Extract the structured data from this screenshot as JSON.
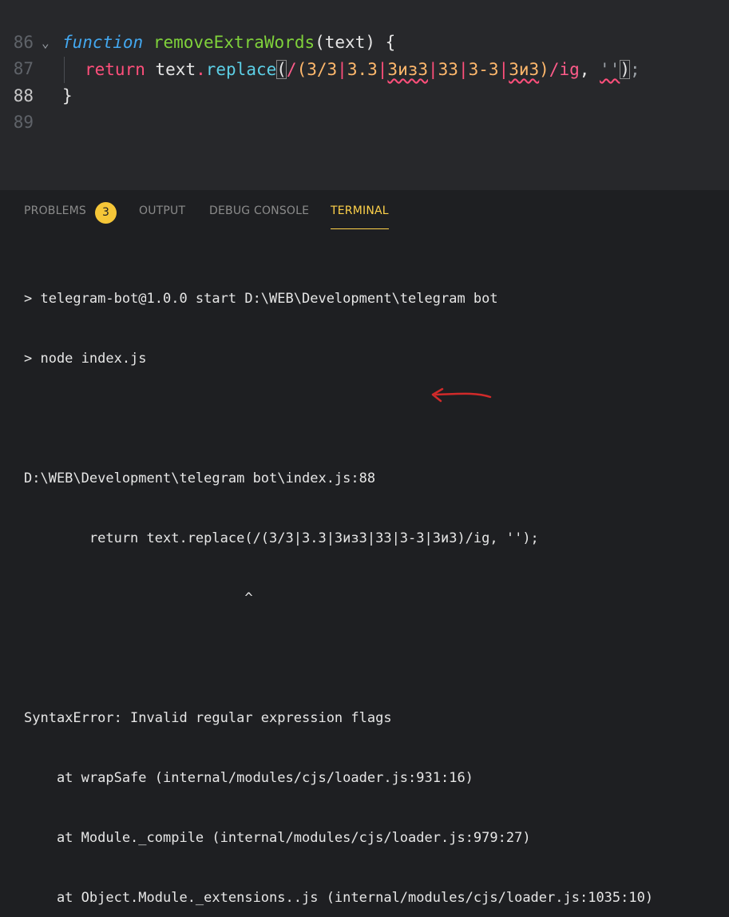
{
  "editor": {
    "lines": [
      {
        "number": "86"
      },
      {
        "number": "87",
        "fold": "⌄",
        "kw": "function",
        "name": "removeExtraWords",
        "open": "(",
        "param": "text",
        "close": ")",
        "brace": " {"
      },
      {
        "number": "88",
        "kw": "return",
        "obj": "text",
        "dot": ".",
        "method": "replace",
        "open": "(",
        "slash": "/",
        "group_open": "(",
        "p1": "3/3",
        "p2": "3.3",
        "p3": "3из3",
        "p4": "33",
        "p5": "3-3",
        "p6": "3и3",
        "bar": "|",
        "group_close": ")",
        "end_slash": "/",
        "flags": "ig",
        "comma": ", ",
        "str": "''",
        "close": ")",
        "semi": ";"
      },
      {
        "number": "89",
        "brace": "}"
      }
    ]
  },
  "panel": {
    "tabs": [
      {
        "label": "PROBLEMS",
        "badge": "3"
      },
      {
        "label": "OUTPUT"
      },
      {
        "label": "DEBUG CONSOLE"
      },
      {
        "label": "TERMINAL"
      }
    ],
    "terminal": [
      "> telegram-bot@1.0.0 start D:\\WEB\\Development\\telegram bot",
      "> node index.js",
      "",
      "D:\\WEB\\Development\\telegram bot\\index.js:88",
      "        return text.replace(/(3/3|3.3|3из3|33|3-3|3и3)/ig, '');",
      "                           ^",
      "",
      "SyntaxError: Invalid regular expression flags",
      "    at wrapSafe (internal/modules/cjs/loader.js:931:16)",
      "    at Module._compile (internal/modules/cjs/loader.js:979:27)",
      "    at Object.Module._extensions..js (internal/modules/cjs/loader.js:1035:10)"
    ]
  },
  "colors": {
    "accent": "#ffd24a",
    "badge": "#f5c638",
    "keyword": "#ff4f7b",
    "function_name": "#7fd13b",
    "regex": "#ffb86c",
    "annotation_arrow": "#d12a2a"
  }
}
